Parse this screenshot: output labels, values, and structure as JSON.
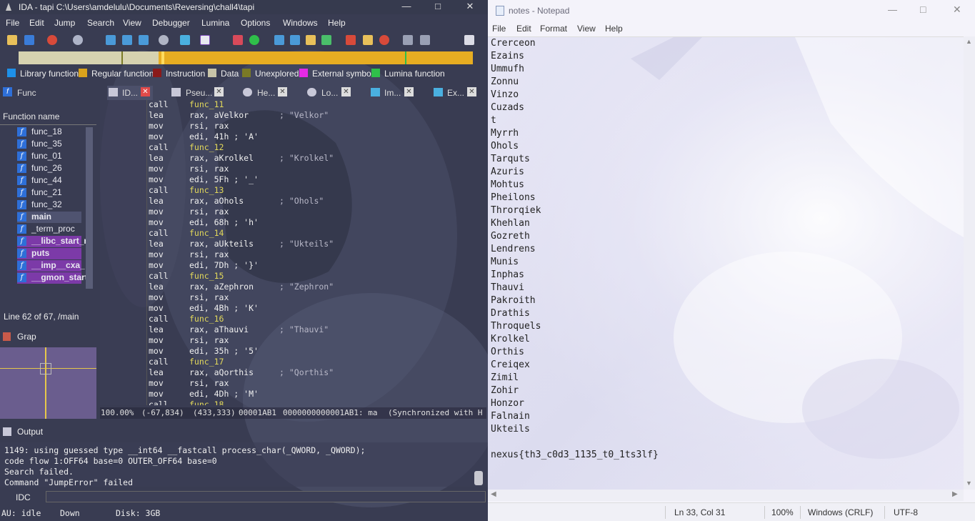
{
  "ida": {
    "title": "IDA - tapi C:\\Users\\amdelulu\\Documents\\Reversing\\chall4\\tapi",
    "menu": [
      "File",
      "Edit",
      "Jump",
      "Search",
      "View",
      "Debugger",
      "Lumina",
      "Options",
      "Windows",
      "Help"
    ],
    "legend": [
      {
        "label": "Library function",
        "color": "#1e90e8"
      },
      {
        "label": "Regular function",
        "color": "#d9a21c"
      },
      {
        "label": "Instruction",
        "color": "#8a1a1a"
      },
      {
        "label": "Data",
        "color": "#c8c4a8"
      },
      {
        "label": "Unexplored",
        "color": "#7a7a26"
      },
      {
        "label": "External symbol",
        "color": "#e52ae5"
      },
      {
        "label": "Lumina function",
        "color": "#2fbf4a"
      }
    ],
    "tabs": {
      "functions": "Func",
      "ida_view": "ID...",
      "pseudo": "Pseu...",
      "hex": "He...",
      "local": "Lo...",
      "imports": "Im...",
      "exports": "Ex..."
    },
    "functions_header": "Function name",
    "functions": [
      {
        "name": "func_18",
        "lib": false
      },
      {
        "name": "func_35",
        "lib": false
      },
      {
        "name": "func_01",
        "lib": false
      },
      {
        "name": "func_26",
        "lib": false
      },
      {
        "name": "func_44",
        "lib": false
      },
      {
        "name": "func_21",
        "lib": false
      },
      {
        "name": "func_32",
        "lib": false
      },
      {
        "name": "main",
        "lib": false
      },
      {
        "name": "_term_proc",
        "lib": false
      },
      {
        "name": "__libc_start_r",
        "lib": true
      },
      {
        "name": "puts",
        "lib": true
      },
      {
        "name": "__imp__cxa_",
        "lib": true
      },
      {
        "name": "__gmon_start",
        "lib": true
      }
    ],
    "line_info": "Line 62 of 67, /main",
    "graph_label": "Grap",
    "asm": [
      {
        "mn": "call",
        "op": "func_11",
        "cm": ""
      },
      {
        "mn": "lea",
        "op": "rax, aVelkor",
        "cm": "; \"Velkor\""
      },
      {
        "mn": "mov",
        "op": "rsi, rax",
        "cm": ""
      },
      {
        "mn": "mov",
        "op": "edi, 41h ; 'A'",
        "cm": ""
      },
      {
        "mn": "call",
        "op": "func_12",
        "cm": ""
      },
      {
        "mn": "lea",
        "op": "rax, aKrolkel",
        "cm": "; \"Krolkel\""
      },
      {
        "mn": "mov",
        "op": "rsi, rax",
        "cm": ""
      },
      {
        "mn": "mov",
        "op": "edi, 5Fh ; '_'",
        "cm": ""
      },
      {
        "mn": "call",
        "op": "func_13",
        "cm": ""
      },
      {
        "mn": "lea",
        "op": "rax, aOhols",
        "cm": "; \"Ohols\""
      },
      {
        "mn": "mov",
        "op": "rsi, rax",
        "cm": ""
      },
      {
        "mn": "mov",
        "op": "edi, 68h ; 'h'",
        "cm": ""
      },
      {
        "mn": "call",
        "op": "func_14",
        "cm": ""
      },
      {
        "mn": "lea",
        "op": "rax, aUkteils",
        "cm": "; \"Ukteils\""
      },
      {
        "mn": "mov",
        "op": "rsi, rax",
        "cm": ""
      },
      {
        "mn": "mov",
        "op": "edi, 7Dh ; '}'",
        "cm": ""
      },
      {
        "mn": "call",
        "op": "func_15",
        "cm": ""
      },
      {
        "mn": "lea",
        "op": "rax, aZephron",
        "cm": "; \"Zephron\""
      },
      {
        "mn": "mov",
        "op": "rsi, rax",
        "cm": ""
      },
      {
        "mn": "mov",
        "op": "edi, 4Bh ; 'K'",
        "cm": ""
      },
      {
        "mn": "call",
        "op": "func_16",
        "cm": ""
      },
      {
        "mn": "lea",
        "op": "rax, aThauvi",
        "cm": "; \"Thauvi\""
      },
      {
        "mn": "mov",
        "op": "rsi, rax",
        "cm": ""
      },
      {
        "mn": "mov",
        "op": "edi, 35h ; '5'",
        "cm": ""
      },
      {
        "mn": "call",
        "op": "func_17",
        "cm": ""
      },
      {
        "mn": "lea",
        "op": "rax, aQorthis",
        "cm": "; \"Qorthis\""
      },
      {
        "mn": "mov",
        "op": "rsi, rax",
        "cm": ""
      },
      {
        "mn": "mov",
        "op": "edi, 4Dh ; 'M'",
        "cm": ""
      },
      {
        "mn": "call",
        "op": "func_18",
        "cm": ""
      }
    ],
    "status": {
      "zoom": "100.00%",
      "coords": "(-67,834)",
      "pos": "(433,333)",
      "offset": "00001AB1",
      "address": "0000000000001AB1: ma",
      "sync": "(Synchronized with H"
    },
    "output_title": "Output",
    "output_lines": [
      "1149: using guessed type __int64 __fastcall process_char(_QWORD, _QWORD);",
      "code flow 1:OFF64 base=0 OUTER_OFF64 base=0",
      "Search failed.",
      "Command \"JumpError\" failed"
    ],
    "idc_label": "IDC",
    "bottom_status": {
      "au": "AU:  idle",
      "dir": "Down",
      "disk": "Disk: 3GB"
    }
  },
  "notepad": {
    "title": "notes - Notepad",
    "menu": [
      "File",
      "Edit",
      "Format",
      "View",
      "Help"
    ],
    "lines": [
      "Crerceon",
      "Ezains",
      "Ummufh",
      "Zonnu",
      "Vinzo",
      "Cuzads",
      "t",
      "Myrrh",
      "Ohols",
      "Tarquts",
      "Azuris",
      "Mohtus",
      "Pheilons",
      "Throrqiek",
      "Khehlan",
      "Gozreth",
      "Lendrens",
      "Munis",
      "Inphas",
      "Thauvi",
      "Pakroith",
      "Drathis",
      "Throquels",
      "Krolkel",
      "Orthis",
      "Creiqex",
      "Zimil",
      "Zohir",
      "Honzor",
      "Falnain",
      "Ukteils"
    ],
    "flag": "nexus{th3_c0d3_1135_t0_1ts3lf}",
    "status": {
      "pos": "Ln 33, Col 31",
      "zoom": "100%",
      "eol": "Windows (CRLF)",
      "enc": "UTF-8"
    }
  }
}
